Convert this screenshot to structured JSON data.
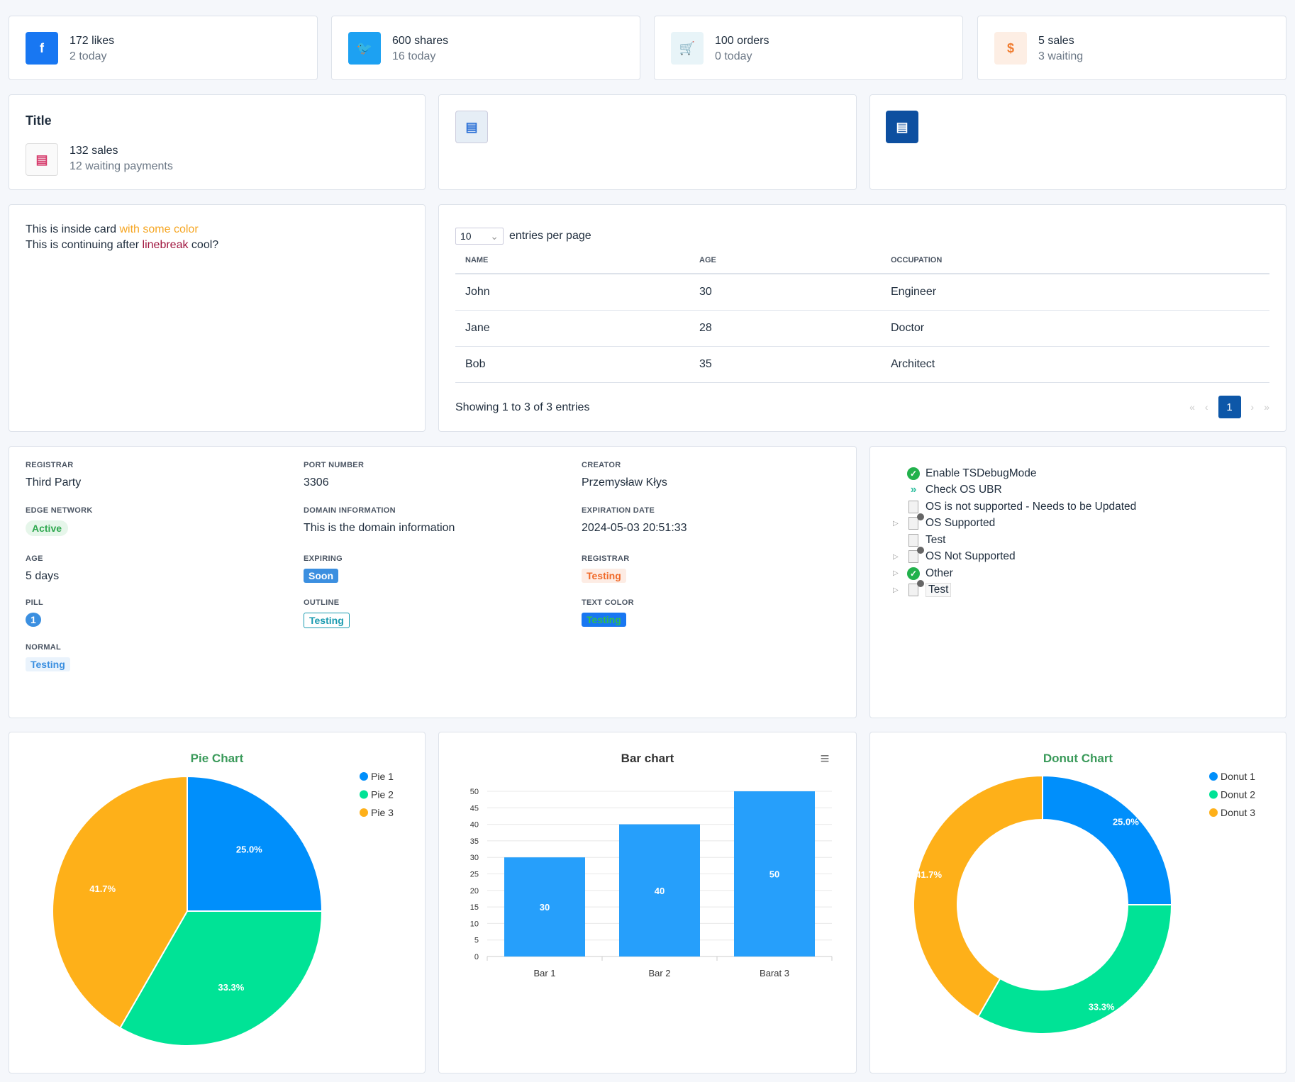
{
  "stats": [
    {
      "icon": "facebook-icon",
      "glyph": "f",
      "main": "172 likes",
      "sub": "2 today",
      "bg": "#1877f2",
      "fg": "#ffffff"
    },
    {
      "icon": "twitter-icon",
      "glyph": "🐦",
      "main": "600 shares",
      "sub": "16 today",
      "bg": "#1da1f2",
      "fg": "#ffffff"
    },
    {
      "icon": "cart-icon",
      "glyph": "🛒",
      "main": "100 orders",
      "sub": "0 today",
      "bg": "#e8f4f8",
      "fg": "#e85d2a"
    },
    {
      "icon": "dollar-icon",
      "glyph": "$",
      "main": "5 sales",
      "sub": "3 waiting",
      "bg": "#fdeee4",
      "fg": "#f07c30"
    }
  ],
  "info_card": {
    "title": "Title",
    "main": "132 sales",
    "sub": "12 waiting payments"
  },
  "text_card": {
    "line1_a": "This is inside card ",
    "line1_b": "with some color",
    "line2_a": "This is continuing after ",
    "line2_b": "linebreak",
    "line2_c": " cool?"
  },
  "table": {
    "page_size": "10",
    "entries_label": "entries per page",
    "columns": [
      "NAME",
      "AGE",
      "OCCUPATION"
    ],
    "rows": [
      [
        "John",
        "30",
        "Engineer"
      ],
      [
        "Jane",
        "28",
        "Doctor"
      ],
      [
        "Bob",
        "35",
        "Architect"
      ]
    ],
    "footer": "Showing 1 to 3 of 3 entries",
    "page": "1",
    "first": "«",
    "prev": "‹",
    "next": "›",
    "last": "»"
  },
  "details": [
    {
      "label": "Registrar",
      "value": "Third Party"
    },
    {
      "label": "Port Number",
      "value": "3306"
    },
    {
      "label": "Creator",
      "value": "Przemysław Kłys"
    },
    {
      "label": "Edge Network",
      "badge": "Active"
    },
    {
      "label": "Domain Information",
      "value": "This is the domain information"
    },
    {
      "label": "Expiration Date",
      "value": "2024-05-03 20:51:33"
    },
    {
      "label": "Age",
      "value": "5 days"
    },
    {
      "label": "Expiring",
      "badge": "Soon"
    },
    {
      "label": "Registrar",
      "badge": "Testing"
    },
    {
      "label": "Pill",
      "badge": "1"
    },
    {
      "label": "Outline",
      "badge": "Testing"
    },
    {
      "label": "Text Color",
      "badge": "Testing"
    },
    {
      "label": "Normal",
      "badge": "Testing"
    }
  ],
  "tree": [
    {
      "label": "Enable TSDebugMode",
      "icon": "check"
    },
    {
      "label": "Check OS UBR",
      "icon": "arrows"
    },
    {
      "label": "OS is not supported - Needs to be Updated",
      "icon": "doc"
    },
    {
      "label": "OS Supported",
      "icon": "doc",
      "expand": true,
      "count": true
    },
    {
      "label": "Test",
      "icon": "doc"
    },
    {
      "label": "OS Not Supported",
      "icon": "doc",
      "expand": true,
      "count": true
    },
    {
      "label": "Other",
      "icon": "check",
      "expand": true
    },
    {
      "label": "Test",
      "icon": "doc",
      "expand": true,
      "count": true
    }
  ],
  "chart_data": [
    {
      "type": "pie",
      "title": "Pie Chart",
      "categories": [
        "Pie 1",
        "Pie 2",
        "Pie 3"
      ],
      "values": [
        25.0,
        33.3,
        41.7
      ],
      "labels": [
        "25.0%",
        "33.3%",
        "41.7%"
      ],
      "colors": [
        "#008ffb",
        "#00e396",
        "#feb019"
      ],
      "legend": "top-right"
    },
    {
      "type": "bar",
      "title": "Bar chart",
      "categories": [
        "Bar 1",
        "Bar 2",
        "Barat 3"
      ],
      "values": [
        30,
        40,
        50
      ],
      "ylim": [
        0,
        50
      ],
      "yticks": [
        0,
        5,
        10,
        15,
        20,
        25,
        30,
        35,
        40,
        45,
        50
      ],
      "color": "#269ffb",
      "grid": true
    },
    {
      "type": "donut",
      "title": "Donut Chart",
      "categories": [
        "Donut 1",
        "Donut 2",
        "Donut 3"
      ],
      "values": [
        25.0,
        33.3,
        41.7
      ],
      "labels": [
        "25.0%",
        "33.3%",
        "41.7%"
      ],
      "colors": [
        "#008ffb",
        "#00e396",
        "#feb019"
      ],
      "legend": "top-right"
    }
  ]
}
